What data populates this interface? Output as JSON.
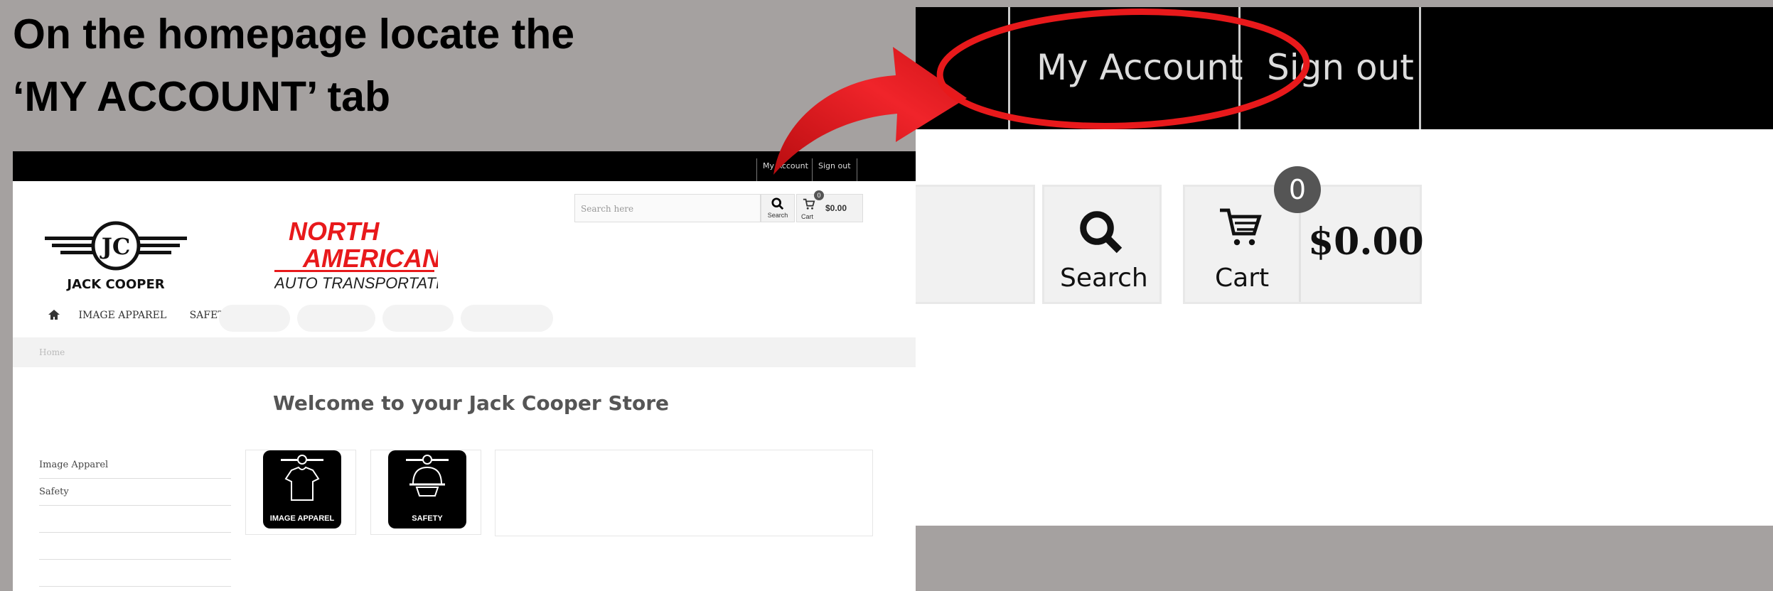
{
  "instruction": {
    "line1": "On the homepage locate the",
    "line2": "‘MY ACCOUNT’ tab"
  },
  "small_screenshot": {
    "top_links": [
      "My Account",
      "Sign out"
    ],
    "search_placeholder": "Search here",
    "search_label": "Search",
    "cart_label": "Cart",
    "cart_count": "0",
    "cart_total": "$0.00",
    "logo_jack_cooper": "JACK COOPER",
    "logo_jc": "JC",
    "logo_north": "NORTH",
    "logo_american": "AMERICAN",
    "logo_auto": "AUTO TRANSPORTATION",
    "nav": [
      "IMAGE APPAREL",
      "SAFETY"
    ],
    "breadcrumb": "Home",
    "welcome": "Welcome to your Jack Cooper Store",
    "sidebar": [
      "Image Apparel",
      "Safety"
    ],
    "tiles": [
      "IMAGE APPAREL",
      "SAFETY"
    ]
  },
  "zoomed": {
    "my_account": "My Account",
    "sign_out": "Sign out",
    "search_label": "Search",
    "cart_label": "Cart",
    "cart_count": "0",
    "cart_total": "$0.00"
  },
  "colors": {
    "background": "#a5a1a0",
    "highlight_red": "#e8191b",
    "bar_black": "#000000"
  },
  "icons": [
    "home-icon",
    "search-icon",
    "cart-icon",
    "shirt-icon",
    "helmet-icon",
    "curved-arrow-icon"
  ]
}
